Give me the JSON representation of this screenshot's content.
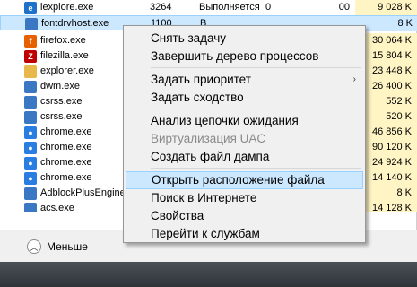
{
  "processes": [
    {
      "name": "iexplore.exe",
      "pid": "3264",
      "status": "Выполняется",
      "user": "0",
      "cpu": "00",
      "mem": "9 028 K",
      "icon": "internet-explorer-icon",
      "iconColor": "#1e73c8",
      "glyph": "e"
    },
    {
      "name": "fontdrvhost.exe",
      "pid": "1100",
      "status": "В",
      "user": "",
      "cpu": "",
      "mem": "8 K",
      "icon": "generic-window-icon",
      "iconColor": "#3a78c3",
      "glyph": ""
    },
    {
      "name": "firefox.exe",
      "pid": "",
      "status": "",
      "user": "",
      "cpu": "",
      "mem": "30 064 K",
      "icon": "firefox-icon",
      "iconColor": "#e66000",
      "glyph": "f"
    },
    {
      "name": "filezilla.exe",
      "pid": "",
      "status": "",
      "user": "",
      "cpu": "",
      "mem": "15 804 K",
      "icon": "filezilla-icon",
      "iconColor": "#bf0000",
      "glyph": "Z"
    },
    {
      "name": "explorer.exe",
      "pid": "",
      "status": "",
      "user": "",
      "cpu": "",
      "mem": "23 448 K",
      "icon": "folder-icon",
      "iconColor": "#e8b84a",
      "glyph": ""
    },
    {
      "name": "dwm.exe",
      "pid": "",
      "status": "",
      "user": "",
      "cpu": "",
      "mem": "26 400 K",
      "icon": "generic-window-icon",
      "iconColor": "#3a78c3",
      "glyph": ""
    },
    {
      "name": "csrss.exe",
      "pid": "",
      "status": "",
      "user": "",
      "cpu": "",
      "mem": "552 K",
      "icon": "generic-window-icon",
      "iconColor": "#3a78c3",
      "glyph": ""
    },
    {
      "name": "csrss.exe",
      "pid": "",
      "status": "",
      "user": "",
      "cpu": "",
      "mem": "520 K",
      "icon": "generic-window-icon",
      "iconColor": "#3a78c3",
      "glyph": ""
    },
    {
      "name": "chrome.exe",
      "pid": "",
      "status": "",
      "user": "",
      "cpu": "",
      "mem": "46 856 K",
      "icon": "chrome-icon",
      "iconColor": "#2a7de1",
      "glyph": "●"
    },
    {
      "name": "chrome.exe",
      "pid": "",
      "status": "",
      "user": "",
      "cpu": "",
      "mem": "90 120 K",
      "icon": "chrome-icon",
      "iconColor": "#2a7de1",
      "glyph": "●"
    },
    {
      "name": "chrome.exe",
      "pid": "",
      "status": "",
      "user": "",
      "cpu": "",
      "mem": "24 924 K",
      "icon": "chrome-icon",
      "iconColor": "#2a7de1",
      "glyph": "●"
    },
    {
      "name": "chrome.exe",
      "pid": "",
      "status": "",
      "user": "",
      "cpu": "",
      "mem": "14 140 K",
      "icon": "chrome-icon",
      "iconColor": "#2a7de1",
      "glyph": "●"
    },
    {
      "name": "AdblockPlusEngine.",
      "pid": "",
      "status": "",
      "user": "",
      "cpu": "",
      "mem": "8 K",
      "icon": "generic-window-icon",
      "iconColor": "#3a78c3",
      "glyph": ""
    },
    {
      "name": "acs.exe",
      "pid": "",
      "status": "",
      "user": "",
      "cpu": "",
      "mem": "14 128 K",
      "icon": "generic-window-icon",
      "iconColor": "#3a78c3",
      "glyph": ""
    }
  ],
  "selected_row": 1,
  "footer": {
    "less_label": "Меньше"
  },
  "context_menu": {
    "items": [
      {
        "label": "Снять задачу"
      },
      {
        "label": "Завершить дерево процессов"
      },
      {
        "label": "Задать приоритет",
        "submenu": true
      },
      {
        "label": "Задать сходство"
      },
      {
        "label": "Анализ цепочки ожидания"
      },
      {
        "label": "Виртуализация UAC",
        "disabled": true
      },
      {
        "label": "Создать файл дампа"
      },
      {
        "label": "Открыть расположение файла",
        "hover": true
      },
      {
        "label": "Поиск в Интернете"
      },
      {
        "label": "Свойства"
      },
      {
        "label": "Перейти к службам"
      }
    ]
  }
}
